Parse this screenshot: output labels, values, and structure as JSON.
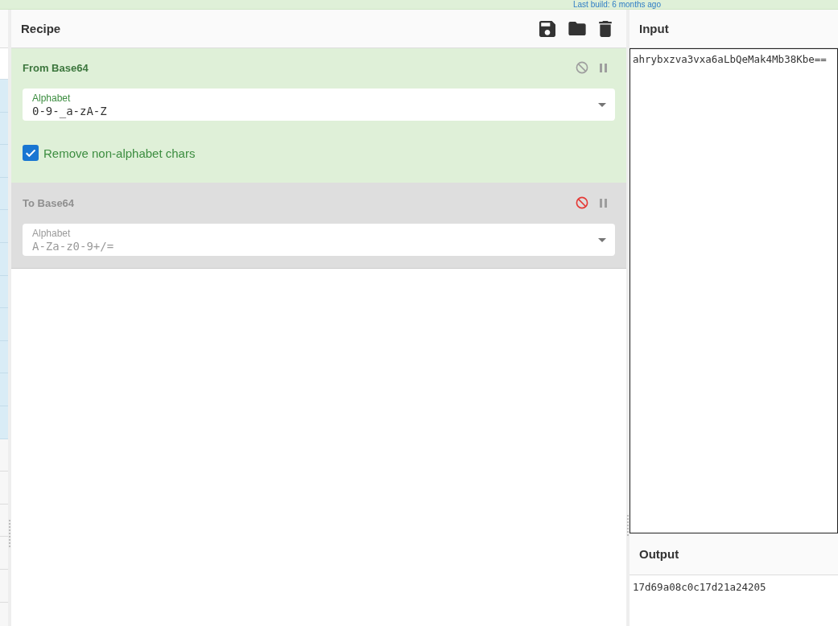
{
  "banner": {
    "text": "Last build: 6 months ago"
  },
  "recipe": {
    "title": "Recipe",
    "operations": [
      {
        "name": "From Base64",
        "disabled": false,
        "fields": [
          {
            "kind": "dropdown",
            "label": "Alphabet",
            "value": "0-9-_a-zA-Z"
          },
          {
            "kind": "checkbox",
            "label": "Remove non-alphabet chars",
            "checked": true
          }
        ]
      },
      {
        "name": "To Base64",
        "disabled": true,
        "fields": [
          {
            "kind": "dropdown",
            "label": "Alphabet",
            "value": "A-Za-z0-9+/="
          }
        ]
      }
    ]
  },
  "input": {
    "title": "Input",
    "value": "ahrybxzva3vxa6aLbQeMak4Mb38Kbe=="
  },
  "output": {
    "title": "Output",
    "value": "17d69a08c0c17d21a24205"
  }
}
